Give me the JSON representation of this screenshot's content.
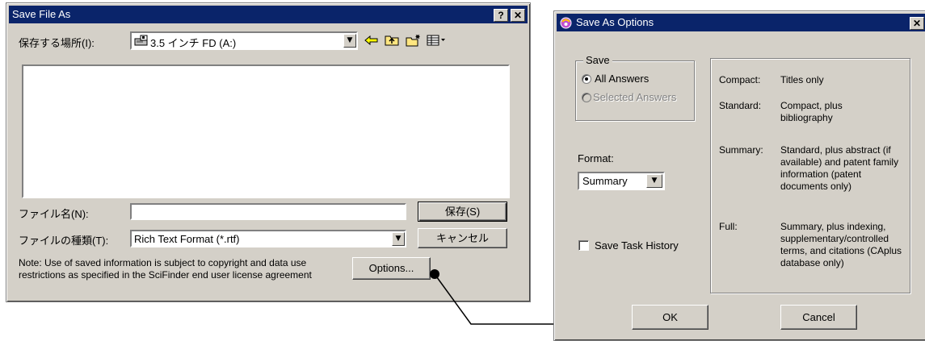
{
  "save_dialog": {
    "title": "Save File As",
    "help_button": "?",
    "close_button": "✕",
    "location_label": "保存する場所(I):",
    "location_value": "3.5 インチ FD (A:)",
    "filename_label": "ファイル名(N):",
    "filename_value": "",
    "filetype_label": "ファイルの種類(T):",
    "filetype_value": "Rich Text Format (*.rtf)",
    "save_button": "保存(S)",
    "cancel_button": "キャンセル",
    "options_button": "Options...",
    "note": "Note:  Use of saved information is subject to copyright and data use restrictions as specified in the SciFinder end user license agreement"
  },
  "options_dialog": {
    "title": "Save As Options",
    "close_button": "✕",
    "save_group_label": "Save",
    "radio_all": "All Answers",
    "radio_selected": "Selected Answers",
    "format_label": "Format:",
    "format_value": "Summary",
    "save_task_history": "Save Task History",
    "save_task_history_checked": false,
    "ok_button": "OK",
    "cancel_button": "Cancel",
    "formats": [
      {
        "name": "Compact:",
        "desc": "Titles only"
      },
      {
        "name": "Standard:",
        "desc": "Compact, plus bibliography"
      },
      {
        "name": "Summary:",
        "desc": "Standard, plus abstract (if available) and patent family information (patent documents only)"
      },
      {
        "name": "Full:",
        "desc": "Summary, plus indexing, supplementary/controlled terms, and citations (CAplus database only)"
      }
    ]
  },
  "colors": {
    "titlebar": "#0a246a",
    "dialog_face": "#d4d0c8"
  }
}
